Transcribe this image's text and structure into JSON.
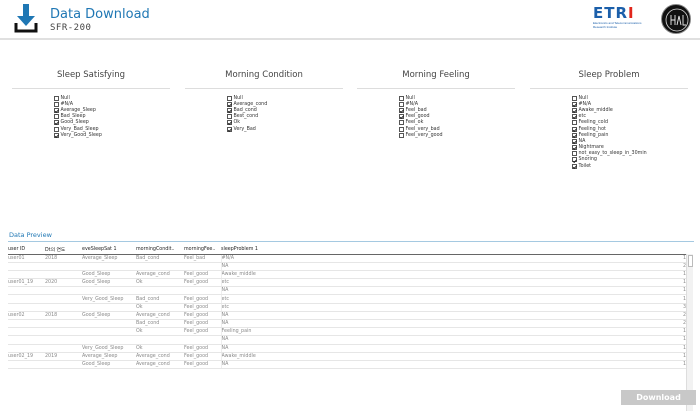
{
  "header": {
    "title": "Data Download",
    "subtitle": "SFR-200",
    "logo_text_blue": "ETR",
    "logo_text_red": "I",
    "logo_tagline": "Electronics and Telecommunications Research Institute"
  },
  "filters": [
    {
      "title": "Sleep Satisfying",
      "options": [
        {
          "label": "Null",
          "checked": false
        },
        {
          "label": "#N/A",
          "checked": false
        },
        {
          "label": "Average_Sleep",
          "checked": true
        },
        {
          "label": "Bad_Sleep",
          "checked": false
        },
        {
          "label": "Good_Sleep",
          "checked": true
        },
        {
          "label": "Very_Bad_Sleep",
          "checked": false
        },
        {
          "label": "Very_Good_Sleep",
          "checked": true
        }
      ]
    },
    {
      "title": "Morning Condition",
      "options": [
        {
          "label": "Null",
          "checked": false
        },
        {
          "label": "Average_cond",
          "checked": true
        },
        {
          "label": "Bad_cond",
          "checked": true
        },
        {
          "label": "Best_cond",
          "checked": false
        },
        {
          "label": "Ok",
          "checked": true
        },
        {
          "label": "Very_Bad",
          "checked": true
        }
      ]
    },
    {
      "title": "Morning Feeling",
      "options": [
        {
          "label": "Null",
          "checked": false
        },
        {
          "label": "#N/A",
          "checked": false
        },
        {
          "label": "Feel_bad",
          "checked": true
        },
        {
          "label": "Feel_good",
          "checked": true
        },
        {
          "label": "Feel_ok",
          "checked": false
        },
        {
          "label": "Feel_very_bad",
          "checked": false
        },
        {
          "label": "Feel_very_good",
          "checked": false
        }
      ]
    },
    {
      "title": "Sleep Problem",
      "options": [
        {
          "label": "Null",
          "checked": false
        },
        {
          "label": "#N/A",
          "checked": true
        },
        {
          "label": "Awake_middle",
          "checked": true
        },
        {
          "label": "etc",
          "checked": true
        },
        {
          "label": "Feeling_cold",
          "checked": false
        },
        {
          "label": "Feeling_hot",
          "checked": true
        },
        {
          "label": "Feeling_pain",
          "checked": true
        },
        {
          "label": "NA",
          "checked": true
        },
        {
          "label": "Nightmare",
          "checked": true
        },
        {
          "label": "not_easy_to_sleep_in_30min",
          "checked": false
        },
        {
          "label": "Snoring",
          "checked": true
        },
        {
          "label": "Toilet",
          "checked": true
        }
      ]
    }
  ],
  "preview": {
    "title": "Data Preview",
    "columns": [
      "user ID",
      "Dt의 연도",
      "eveSleepSat 1",
      "morningCondit..",
      "morningFee..",
      "sleepProblem 1",
      ""
    ],
    "rows": [
      [
        "user01",
        "2018",
        "Average_Sleep",
        "Bad_cond",
        "Feel_bad",
        "#N/A",
        "1"
      ],
      [
        "",
        "",
        "",
        "",
        "",
        "NA",
        "2"
      ],
      [
        "",
        "",
        "Good_Sleep",
        "Average_cond",
        "Feel_good",
        "Awake_middle",
        "1"
      ],
      [
        "user01_19",
        "2020",
        "Good_Sleep",
        "Ok",
        "Feel_good",
        "etc",
        "1"
      ],
      [
        "",
        "",
        "",
        "",
        "",
        "NA",
        "1"
      ],
      [
        "",
        "",
        "Very_Good_Sleep",
        "Bad_cond",
        "Feel_good",
        "etc",
        "1"
      ],
      [
        "",
        "",
        "",
        "Ok",
        "Feel_good",
        "etc",
        "3"
      ],
      [
        "user02",
        "2018",
        "Good_Sleep",
        "Average_cond",
        "Feel_good",
        "NA",
        "2"
      ],
      [
        "",
        "",
        "",
        "Bad_cond",
        "Feel_good",
        "NA",
        "2"
      ],
      [
        "",
        "",
        "",
        "Ok",
        "Feel_good",
        "Feeling_pain",
        "1"
      ],
      [
        "",
        "",
        "",
        "",
        "",
        "NA",
        "1"
      ],
      [
        "",
        "",
        "Very_Good_Sleep",
        "Ok",
        "Feel_good",
        "NA",
        "1"
      ],
      [
        "user02_19",
        "2019",
        "Average_Sleep",
        "Average_cond",
        "Feel_good",
        "Awake_middle",
        "1"
      ],
      [
        "",
        "",
        "Good_Sleep",
        "Average_cond",
        "Feel_good",
        "NA",
        "1"
      ]
    ]
  },
  "download_label": "Download",
  "colors": {
    "accent": "#1f77b4",
    "button_disabled": "#c8c8c8"
  }
}
